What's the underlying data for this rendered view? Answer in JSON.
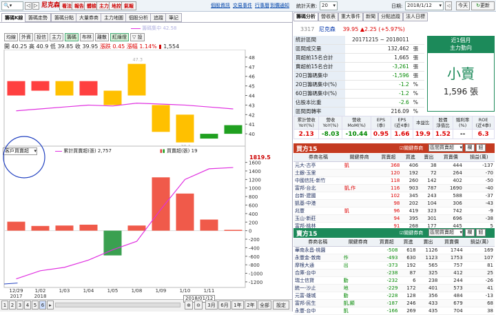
{
  "topbar": {
    "query_value": "",
    "stock_name": "尼克森",
    "buttons": [
      "看法",
      "報告",
      "體檢",
      "主力",
      "地控",
      "氣報"
    ],
    "links": [
      "個股資訊",
      "交易事件",
      "行事曆",
      "到價通知"
    ],
    "period_label": "統計天數:",
    "period_value": "20",
    "date_label": "日期:",
    "date_value": "2018/1/12",
    "today_button": "今天",
    "refresh_button": "更新"
  },
  "main_tabs": [
    "籌碼K線",
    "籌碼走勢",
    "籌碼分點",
    "大量券商",
    "主力地圖",
    "個股分析",
    "追蹤",
    "筆記"
  ],
  "right_tabs": [
    "籌碼分析",
    "營收表",
    "重大事件",
    "新聞",
    "分點追蹤",
    "法人日標"
  ],
  "chart_toolbar": {
    "buttons": [
      "均線",
      "外資",
      "投信",
      "主力",
      "籌碼",
      "布林",
      "離散",
      "紅綠燈"
    ],
    "extra": "▽ 設",
    "legend_text": "籌碼集中 42.58"
  },
  "ohlc": {
    "open_label": "開",
    "open": "40.25",
    "high_label": "高",
    "high": "40.9",
    "low_label": "低",
    "low": "39.85",
    "close_label": "收",
    "close": "39.95",
    "chg_label": "漲跌",
    "chg": "0.45",
    "pct_label": "漲幅",
    "pct": "1.14%",
    "vol": "1,554"
  },
  "lower_panel": {
    "selector": "客戶買賣超",
    "legend1": "累計買賣超(張) 2,757",
    "legend2": "買賣超(張) 19",
    "top_value": "1819.5"
  },
  "chart_data": [
    {
      "type": "candlestick",
      "categories": [
        "12/29",
        "01/02",
        "01/03",
        "01/04",
        "01/05",
        "01/08",
        "01/09",
        "01/10",
        "01/11",
        "01/12"
      ],
      "x_tick_labels": [
        "12/29\n2017",
        "1/02\n2018",
        "1/03",
        "1/04",
        "1/05",
        "1/08",
        "1/09",
        "1/10",
        "1/11"
      ],
      "candles": [
        {
          "open": 44.0,
          "close": 45.5,
          "color": "#ff4040"
        },
        {
          "open": 44.5,
          "close": 45.5,
          "color": "#ff4040"
        },
        {
          "open": 44.0,
          "close": 45.5,
          "color": "#ffc000"
        },
        {
          "open": 44.0,
          "close": 45.5,
          "color": "#ff4040"
        },
        {
          "open": 43.0,
          "close": 44.5,
          "color": "#ffc000"
        },
        {
          "open": 44.0,
          "close": 47.3,
          "color": "#ffc000"
        },
        {
          "open": 43.0,
          "close": 40.2,
          "color": "#ffc000"
        },
        {
          "open": 39.1,
          "close": 42.0,
          "color": "#ffc000"
        },
        {
          "open": 39.5,
          "close": 40.0,
          "color": "#20a020"
        },
        {
          "open": 40.0,
          "close": 40.9,
          "color": "#20a020"
        }
      ],
      "line": {
        "name": "籌碼集中",
        "values": [
          42.4,
          42.6,
          42.8,
          43.0,
          42.9,
          43.2,
          43.1,
          43.0,
          42.8,
          42.6
        ],
        "color": "#e030e0"
      },
      "annotations": [
        {
          "index": 5,
          "text": "47.3"
        },
        {
          "index": 7,
          "text": "39.1"
        }
      ],
      "y_ticks": [
        40,
        41,
        42,
        43,
        44,
        45,
        46,
        47,
        48
      ],
      "ylim": [
        39,
        48.5
      ]
    },
    {
      "type": "bar",
      "categories": [
        "12/29",
        "01/02",
        "01/03",
        "01/04",
        "01/05",
        "01/08",
        "01/09",
        "01/10",
        "01/11",
        "01/12"
      ],
      "series": [
        {
          "name": "買賣超(張)",
          "values": [
            210,
            110,
            120,
            140,
            -580,
            120,
            1250,
            870,
            260,
            19
          ]
        },
        {
          "name": "累計買賣超(張)",
          "values": [
            -1130,
            -940,
            -860,
            -690,
            -450,
            -250,
            500,
            1200,
            1450,
            1480
          ]
        }
      ],
      "y_ticks": [
        1600,
        1400,
        1200,
        1000,
        800,
        600,
        400,
        200,
        0,
        -200,
        -400,
        -600,
        -800,
        -1000,
        -1200
      ],
      "ylim": [
        -1250,
        1820
      ]
    }
  ],
  "chart_footer": {
    "date_box": "2018/01/12",
    "page_buttons": [
      "1",
      "2",
      "3",
      "4",
      "5",
      "6"
    ],
    "zoom_in": "+",
    "zoom_out": "-",
    "range_buttons": [
      "3月",
      "6月",
      "1年",
      "2年",
      "全部"
    ],
    "settings": "設定"
  },
  "summary": {
    "code": "3317",
    "name": "尼克森",
    "price": "39.95",
    "change": "▲2.25 (+5.97%)",
    "rows": [
      {
        "k": "統計區間",
        "v": "20171215 ~ 2018011",
        "u": ""
      },
      {
        "k": "區間成交量",
        "v": "132,462",
        "u": "張"
      },
      {
        "k": "買超前15名合計",
        "v": "1,665",
        "u": "張"
      },
      {
        "k": "賣超前15名合計",
        "v": "-3,261",
        "u": "張"
      },
      {
        "k": "20日籌碼集中",
        "v": "-1,596",
        "u": "張"
      },
      {
        "k": "20日籌碼集中(%)",
        "v": "-1.2",
        "u": "%"
      },
      {
        "k": "60日籌碼集中(%)",
        "v": "-1.2",
        "u": "%"
      },
      {
        "k": "佔股本比重",
        "v": "-2.6",
        "u": "%"
      },
      {
        "k": "區間周轉率",
        "v": "216.09",
        "u": "%"
      }
    ],
    "signal_title": "近1個月",
    "signal_sub": "主力動向",
    "signal_word": "小賣",
    "signal_value": "1,596 張"
  },
  "metrics": {
    "headers": [
      "累計營收\nYoY(%)",
      "營收\nYoY(%)",
      "營收\nMoM(%)",
      "EPS\n(季)",
      "EPS\n(近4季)",
      "本益比",
      "股價\n淨值比",
      "殖利率\n(%)",
      "ROE\n(近4季)"
    ],
    "values": [
      "2.13",
      "-8.03",
      "-10.44",
      "0.95",
      "1.66",
      "19.9",
      "1.52",
      "--",
      "6.3"
    ]
  },
  "buy_table": {
    "title": "買方15",
    "select_label": "關鍵券商",
    "select_value": "區間買賣超",
    "btn1": "欄",
    "btn2": "鈕",
    "headers": [
      "券商名稱",
      "關鍵券商",
      "買賣超",
      "買進",
      "賣出",
      "買賣價",
      "損益(萬)"
    ],
    "rows": [
      [
        "元大-古亭",
        "凱",
        "368",
        "406",
        "38",
        "444",
        "-137"
      ],
      [
        "土銀-玉里",
        "",
        "120",
        "192",
        "72",
        "264",
        "-70"
      ],
      [
        "中國信託-新竹",
        "",
        "118",
        "260",
        "142",
        "402",
        "-50"
      ],
      [
        "富邦-台北",
        "凱,作",
        "116",
        "903",
        "787",
        "1690",
        "-40"
      ],
      [
        "台新-建國",
        "",
        "102",
        "345",
        "243",
        "588",
        "-37"
      ],
      [
        "凱基-中港",
        "",
        "98",
        "202",
        "104",
        "306",
        "-43"
      ],
      [
        "兆豐",
        "凱",
        "96",
        "419",
        "323",
        "742",
        "-9"
      ],
      [
        "玉山-新莊",
        "",
        "94",
        "395",
        "301",
        "696",
        "-38"
      ],
      [
        "富邦-桃林",
        "",
        "91",
        "268",
        "177",
        "445",
        "5"
      ]
    ]
  },
  "sell_table": {
    "title": "賣方15",
    "select_label": "關鍵券商",
    "select_value": "區間買賣超",
    "btn1": "欄",
    "btn2": "鈕",
    "headers": [
      "券商名稱",
      "關鍵券商",
      "買賣超",
      "買進",
      "賣出",
      "買賣價",
      "損益(萬)"
    ],
    "rows": [
      [
        "華南永昌-桃園",
        "",
        "-508",
        "618",
        "1126",
        "1744",
        "169"
      ],
      [
        "永豐金-敦南",
        "作",
        "-493",
        "630",
        "1123",
        "1753",
        "107"
      ],
      [
        "摩根大通",
        "出",
        "-373",
        "192",
        "565",
        "757",
        "81"
      ],
      [
        "合庫-台中",
        "",
        "-238",
        "87",
        "325",
        "412",
        "25"
      ],
      [
        "瑞士信貸",
        "動",
        "-232",
        "6",
        "238",
        "244",
        "-26"
      ],
      [
        "統一-沙止",
        "地",
        "-229",
        "172",
        "401",
        "573",
        "41"
      ],
      [
        "元富-雄城",
        "動",
        "-228",
        "128",
        "356",
        "484",
        "-13"
      ],
      [
        "富邦-民生",
        "凱,顯",
        "-187",
        "246",
        "433",
        "679",
        "68"
      ],
      [
        "永豐-台中",
        "凱",
        "-166",
        "269",
        "435",
        "704",
        "38"
      ]
    ]
  }
}
